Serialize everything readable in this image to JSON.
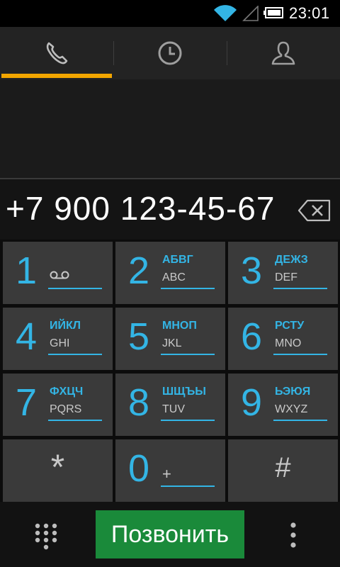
{
  "status_bar": {
    "time": "23:01",
    "icons": [
      "wifi-icon",
      "signal-icon",
      "battery-icon"
    ],
    "wifi_color": "#33b5e5"
  },
  "tabs": [
    {
      "name": "phone",
      "icon": "phone-icon",
      "active": true
    },
    {
      "name": "call-log",
      "icon": "clock-icon",
      "active": false
    },
    {
      "name": "contacts",
      "icon": "person-icon",
      "active": false
    }
  ],
  "dialer": {
    "number": "+7 900 123-45-67"
  },
  "keys": [
    {
      "digit": "1",
      "cyr": "",
      "lat": ""
    },
    {
      "digit": "2",
      "cyr": "АБВГ",
      "lat": "ABC"
    },
    {
      "digit": "3",
      "cyr": "ДЕЖЗ",
      "lat": "DEF"
    },
    {
      "digit": "4",
      "cyr": "ИЙКЛ",
      "lat": "GHI"
    },
    {
      "digit": "5",
      "cyr": "МНОП",
      "lat": "JKL"
    },
    {
      "digit": "6",
      "cyr": "РСТУ",
      "lat": "MNO"
    },
    {
      "digit": "7",
      "cyr": "ФХЦЧ",
      "lat": "PQRS"
    },
    {
      "digit": "8",
      "cyr": "ШЩЪЫ",
      "lat": "TUV"
    },
    {
      "digit": "9",
      "cyr": "ЬЭЮЯ",
      "lat": "WXYZ"
    },
    {
      "digit": "*",
      "cyr": "",
      "lat": ""
    },
    {
      "digit": "0",
      "cyr": "",
      "lat": "+"
    },
    {
      "digit": "#",
      "cyr": "",
      "lat": ""
    }
  ],
  "bottom": {
    "call_label": "Позвонить"
  },
  "colors": {
    "accent": "#33b5e5",
    "tab_indicator": "#f3a600",
    "call_button": "#1a8a3a"
  }
}
